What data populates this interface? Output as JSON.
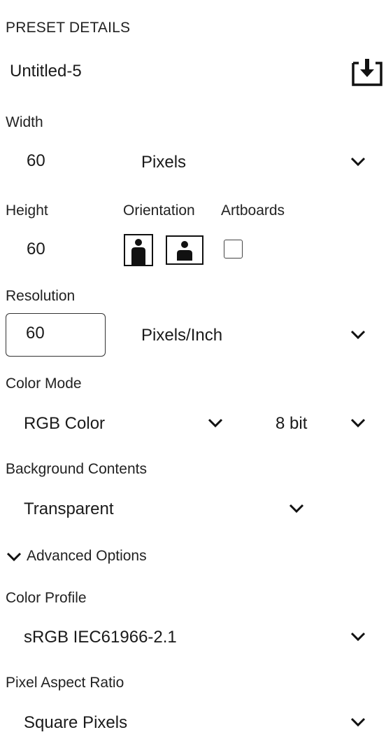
{
  "preset": {
    "section_title": "PRESET DETAILS",
    "name": "Untitled-5",
    "save_icon": "save-preset-icon"
  },
  "width": {
    "label": "Width",
    "value": "60",
    "unit": "Pixels"
  },
  "height": {
    "label": "Height",
    "value": "60"
  },
  "orientation": {
    "label": "Orientation",
    "selected": "portrait"
  },
  "artboards": {
    "label": "Artboards",
    "checked": false
  },
  "resolution": {
    "label": "Resolution",
    "value": "60",
    "unit": "Pixels/Inch"
  },
  "color_mode": {
    "label": "Color Mode",
    "mode": "RGB Color",
    "depth": "8 bit"
  },
  "background": {
    "label": "Background Contents",
    "value": "Transparent"
  },
  "advanced": {
    "label": "Advanced Options",
    "expanded": true
  },
  "color_profile": {
    "label": "Color Profile",
    "value": "sRGB IEC61966-2.1"
  },
  "pixel_aspect": {
    "label": "Pixel Aspect Ratio",
    "value": "Square Pixels"
  }
}
